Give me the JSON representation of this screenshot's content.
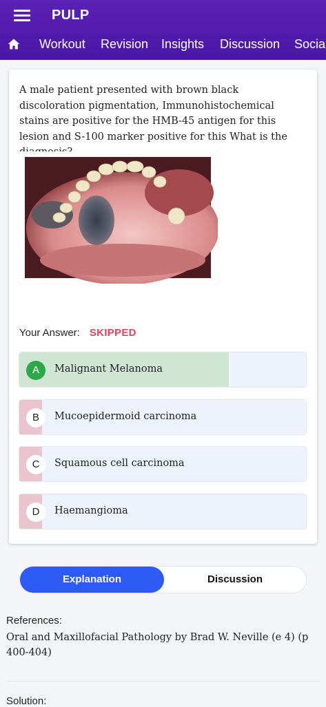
{
  "app": {
    "title": "PULP"
  },
  "nav": {
    "items": [
      "Workout",
      "Revision",
      "Insights",
      "Discussion",
      "Social"
    ]
  },
  "question": {
    "text": "A male patient presented with brown black discoloration pigmentation, Immunohistochemical stains are positive for the HMB-45 antigen for this lesion and S-100 marker positive for this What is the diagnosis?"
  },
  "answer": {
    "label": "Your Answer:",
    "status": "SKIPPED"
  },
  "options": [
    {
      "letter": "A",
      "text": "Malignant Melanoma",
      "state": "correct",
      "fill_percent": 73
    },
    {
      "letter": "B",
      "text": "Mucoepidermoid carcinoma",
      "state": "wrong",
      "fill_percent": 8
    },
    {
      "letter": "C",
      "text": "Squamous cell carcinoma",
      "state": "wrong",
      "fill_percent": 8
    },
    {
      "letter": "D",
      "text": "Haemangioma",
      "state": "wrong",
      "fill_percent": 8
    }
  ],
  "colors": {
    "correct_fill": "#cfe6d4",
    "wrong_fill": "#ebc5cd",
    "accent": "#2e5bf6",
    "skipped": "#e0425b",
    "appbar": "#5a22b4"
  },
  "tabs": {
    "active": "Explanation",
    "inactive": "Discussion"
  },
  "references": {
    "label": "References:",
    "text": "Oral and Maxillofacial Pathology by Brad W. Neville (e 4) (p 400-404)"
  },
  "solution": {
    "label": "Solution:"
  }
}
